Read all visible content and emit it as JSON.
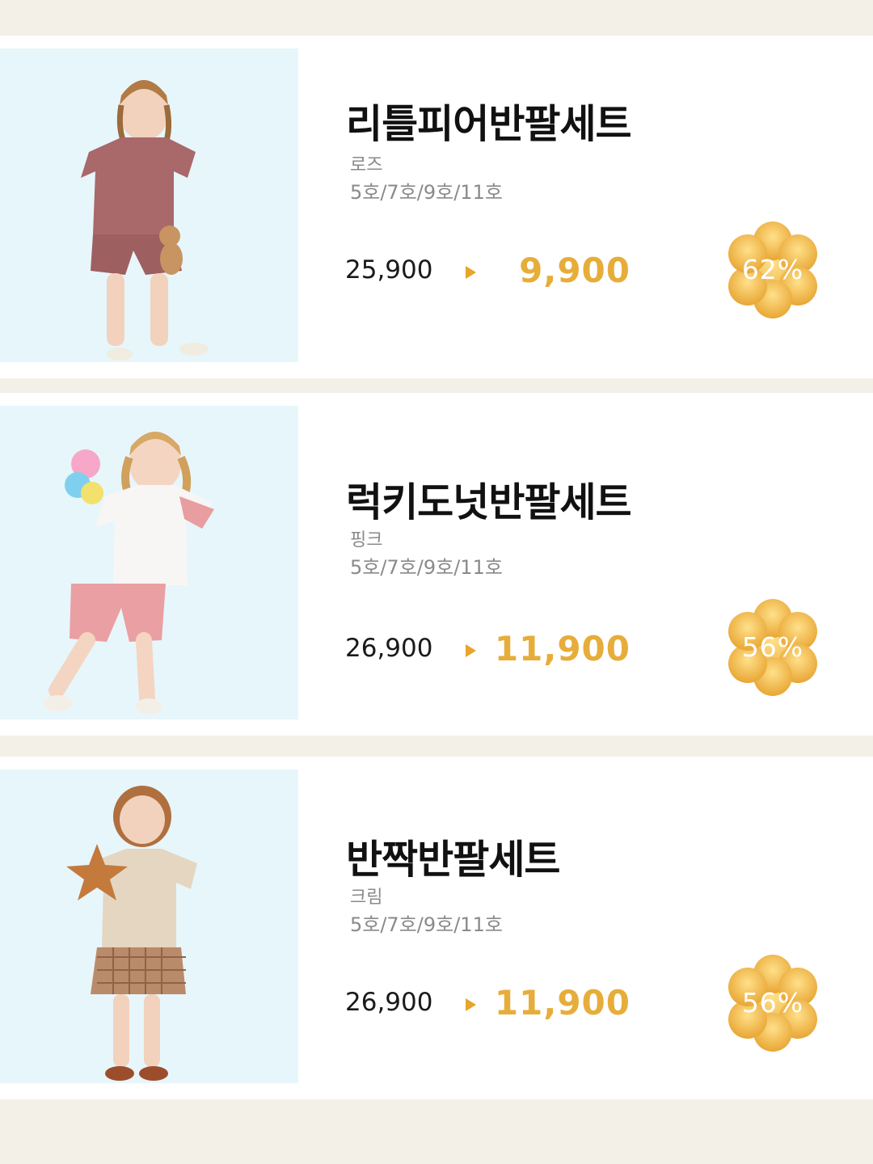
{
  "products": [
    {
      "name": "리틀피어반팔세트",
      "color": "로즈",
      "sizes": "5호/7호/9호/11호",
      "original_price": "25,900",
      "sale_price": "9,900",
      "discount": "62%"
    },
    {
      "name": "럭키도넛반팔세트",
      "color": "핑크",
      "sizes": "5호/7호/9호/11호",
      "original_price": "26,900",
      "sale_price": "11,900",
      "discount": "56%"
    },
    {
      "name": "반짝반팔세트",
      "color": "크림",
      "sizes": "5호/7호/9호/11호",
      "original_price": "26,900",
      "sale_price": "11,900",
      "discount": "56%"
    }
  ],
  "colors": {
    "background": "#f3f0e8",
    "card": "#ffffff",
    "photo_bg": "#e7f6fb",
    "sale_price": "#e7ad3a",
    "badge_light": "#ffd57a",
    "badge_dark": "#e9a935",
    "arrow": "#e7a52a"
  },
  "icons": {
    "price_arrow": "triangle-right-icon",
    "discount_badge": "flower-badge-icon"
  }
}
